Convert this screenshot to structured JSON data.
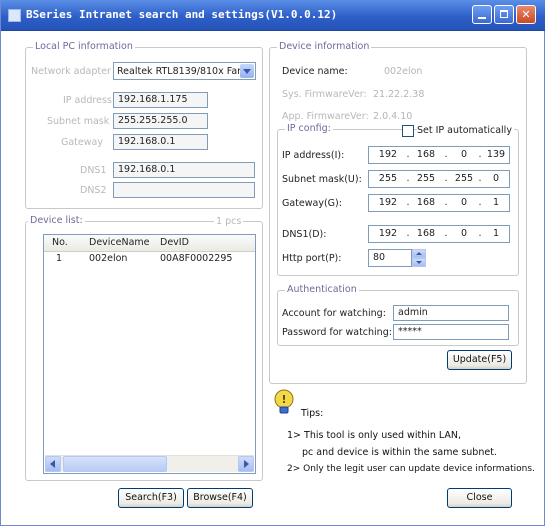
{
  "window": {
    "title": "BSeries Intranet search and settings(V1.0.0.12)",
    "icon": "app-icon"
  },
  "local_pc": {
    "legend": "Local PC information",
    "network_adapter_label": "Network adapter",
    "network_adapter_value": "Realtek RTL8139/810x Far",
    "ip_label": "IP address",
    "ip_value": "192.168.1.175",
    "subnet_label": "Subnet mask",
    "subnet_value": "255.255.255.0",
    "gateway_label": "Gateway",
    "gateway_value": "192.168.0.1",
    "dns1_label": "DNS1",
    "dns1_value": "192.168.0.1",
    "dns2_label": "DNS2",
    "dns2_value": ""
  },
  "device_list": {
    "legend": "Device list:",
    "count_label": "1 pcs",
    "columns": [
      "No.",
      "DeviceName",
      "DevID"
    ],
    "rows": [
      {
        "no": "1",
        "name": "002elon",
        "devid": "00A8F0002295"
      }
    ]
  },
  "buttons": {
    "search": "Search(F3)",
    "browse": "Browse(F4)",
    "update": "Update(F5)",
    "close": "Close"
  },
  "device_info": {
    "legend": "Device information",
    "device_name_label": "Device name:",
    "device_name_value": "002elon",
    "sys_fw_label": "Sys. FirmwareVer:",
    "sys_fw_value": "21.22.2.38",
    "app_fw_label": "App. FirmwareVer:",
    "app_fw_value": "2.0.4.10"
  },
  "ip_config": {
    "legend": "IP config:",
    "auto_label": "Set IP automatically",
    "ip_label": "IP address(I):",
    "ip_octets": [
      "192",
      "168",
      "0",
      "139"
    ],
    "subnet_label": "Subnet mask(U):",
    "subnet_octets": [
      "255",
      "255",
      "255",
      "0"
    ],
    "gateway_label": "Gateway(G):",
    "gateway_octets": [
      "192",
      "168",
      "0",
      "1"
    ],
    "dns1_label": "DNS1(D):",
    "dns1_octets": [
      "192",
      "168",
      "0",
      "1"
    ],
    "http_port_label": "Http port(P):",
    "http_port_value": "80"
  },
  "auth": {
    "legend": "Authentication",
    "account_label": "Account for watching:",
    "account_value": "admin",
    "password_label": "Password for watching:",
    "password_value": "*****"
  },
  "tips": {
    "title": "Tips:",
    "line1": "1> This tool is only used within LAN,",
    "line2": "pc and device is within the same subnet.",
    "line3": "2> Only the legit user can update  device informations."
  }
}
